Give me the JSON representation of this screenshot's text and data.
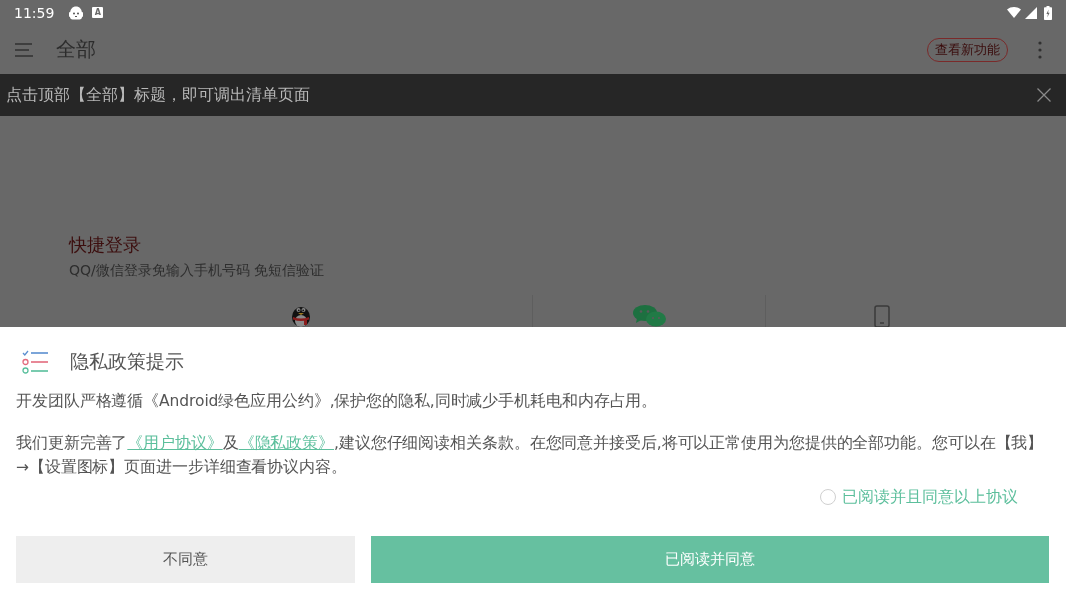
{
  "status_bar": {
    "time": "11:59",
    "badge_letter": "A"
  },
  "app_bar": {
    "title": "全部",
    "action_button": "查看新功能"
  },
  "toast": {
    "message": "点击顶部【全部】标题，即可调出清单页面"
  },
  "quick_login": {
    "title": "快捷登录",
    "subtitle": "QQ/微信登录免输入手机号码 免短信验证",
    "options": [
      {
        "kind": "qq"
      },
      {
        "kind": "wechat"
      },
      {
        "kind": "phone"
      }
    ]
  },
  "dialog": {
    "title": "隐私政策提示",
    "paragraphs": [
      [
        {
          "kind": "text",
          "text": "开发团队严格遵循《Android绿色应用公约》,保护您的隐私,同时减少手机耗电和内存占用。"
        }
      ],
      [
        {
          "kind": "text",
          "text": "我们更新完善了"
        },
        {
          "kind": "link",
          "text": "《用户协议》"
        },
        {
          "kind": "text",
          "text": "及"
        },
        {
          "kind": "link",
          "text": "《隐私政策》"
        },
        {
          "kind": "text",
          "text": ",建议您仔细阅读相关条款。在您同意并接受后,将可以正常使用为您提供的全部功能。您可以在【我】→【设置图标】页面进一步详细查看协议内容。"
        }
      ]
    ],
    "agreement": {
      "label": "已阅读并且同意以上协议",
      "checked": false
    },
    "buttons": [
      {
        "kind": "secondary",
        "label": "不同意"
      },
      {
        "kind": "primary",
        "label": "已阅读并同意"
      }
    ]
  }
}
